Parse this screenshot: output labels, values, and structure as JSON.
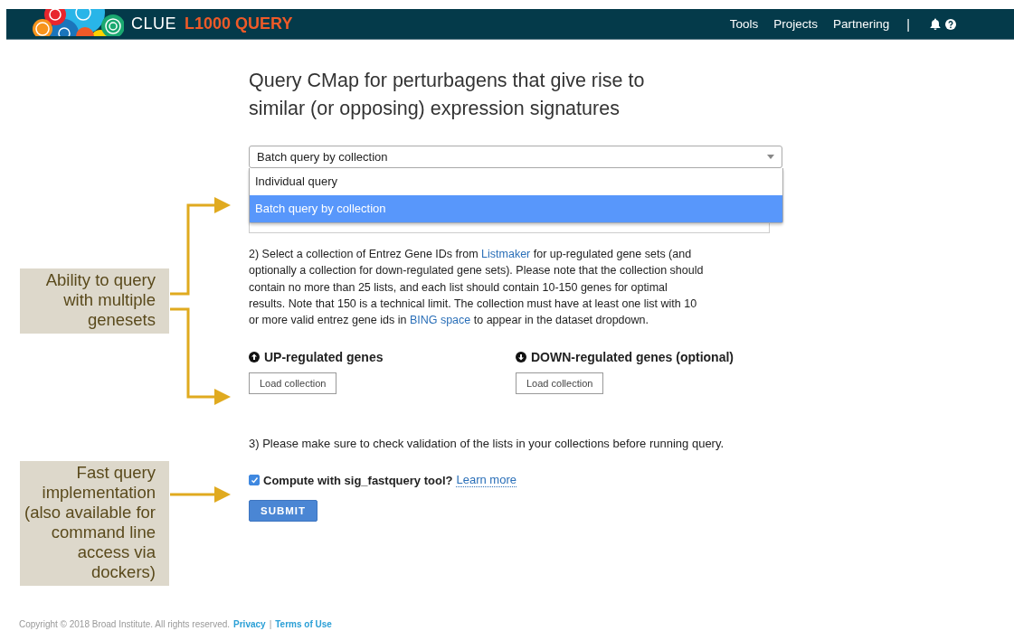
{
  "header": {
    "brand": "CLUE",
    "product": "L1000 QUERY",
    "nav": [
      "Tools",
      "Projects",
      "Partnering"
    ],
    "separator": "|"
  },
  "title": "Query CMap for perturbagens that give rise to similar (or opposing) expression signatures",
  "query_type": {
    "value": "Batch query by collection",
    "options": [
      {
        "label": "Individual query",
        "selected": false
      },
      {
        "label": "Batch query by collection",
        "selected": true
      }
    ]
  },
  "step2": {
    "parts": [
      "2) Select a collection of Entrez Gene IDs from ",
      {
        "link": "Listmaker"
      },
      " for up-regulated gene sets (and optionally a collection for down-regulated gene sets). Please note that the collection should contain no more than 25 lists, and each list should contain 10-150 genes for optimal results. Note that 150 is a technical limit. The collection must have at least one list with 10 or more valid entrez gene ids in ",
      {
        "link": "BING space"
      },
      " to appear in the dataset dropdown."
    ]
  },
  "gene_sets": [
    {
      "kind": "up",
      "heading": "UP-regulated genes",
      "button": "Load collection"
    },
    {
      "kind": "down",
      "heading": "DOWN-regulated genes (optional)",
      "button": "Load collection"
    }
  ],
  "step3": "3) Please make sure to check validation of the lists in your collections before running query.",
  "fastquery": {
    "label": "Compute with sig_fastquery tool?",
    "checked": true,
    "link": "Learn more"
  },
  "submit": "SUBMIT",
  "footer": {
    "copyright": "Copyright © 2018 Broad Institute. All rights reserved.",
    "links": [
      "Privacy",
      "Terms of Use"
    ],
    "separator": "|"
  },
  "annotations": [
    "Ability to query with multiple genesets",
    "Fast query implementation (also available for command line access via dockers)"
  ]
}
